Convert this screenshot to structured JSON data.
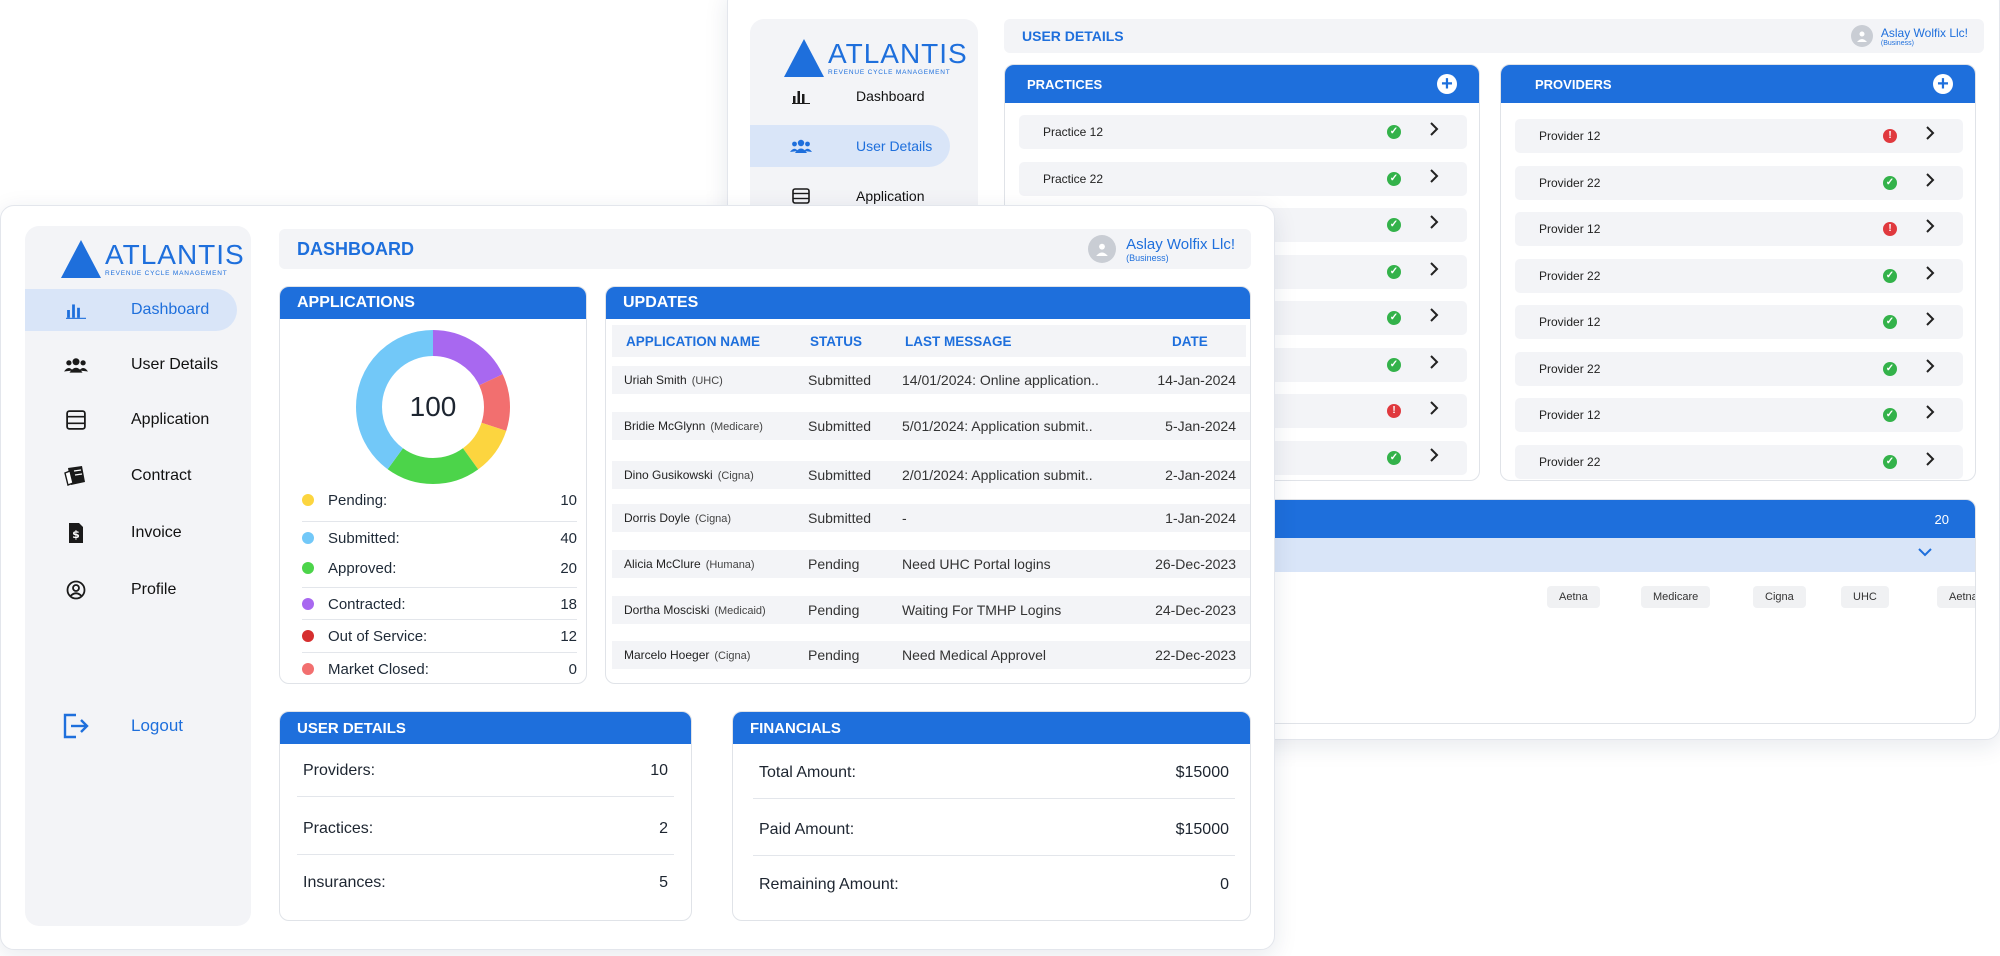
{
  "brand": {
    "name": "ATLANTIS",
    "tagline": "REVENUE CYCLE MANAGEMENT"
  },
  "colors": {
    "primary": "#1e6fdc",
    "ok": "#33b24a",
    "error": "#e0393e"
  },
  "user": {
    "name": "Aslay Wolfix Llc!",
    "role": "(Business)"
  },
  "back": {
    "title": "USER DETAILS",
    "nav": [
      {
        "label": "Dashboard",
        "icon": "bar-chart-icon"
      },
      {
        "label": "User Details",
        "icon": "users-icon"
      },
      {
        "label": "Application",
        "icon": "list-icon"
      }
    ],
    "practices": {
      "title": "PRACTICES",
      "items": [
        {
          "label": "Practice 12",
          "status": "ok"
        },
        {
          "label": "Practice 22",
          "status": "ok"
        },
        {
          "label": "",
          "status": "ok"
        },
        {
          "label": "",
          "status": "ok"
        },
        {
          "label": "",
          "status": "ok"
        },
        {
          "label": "",
          "status": "ok"
        },
        {
          "label": "",
          "status": "err"
        },
        {
          "label": "",
          "status": "ok"
        }
      ]
    },
    "providers": {
      "title": "PROVIDERS",
      "items": [
        {
          "label": "Provider 12",
          "status": "err"
        },
        {
          "label": "Provider 22",
          "status": "ok"
        },
        {
          "label": "Provider 12",
          "status": "err"
        },
        {
          "label": "Provider 22",
          "status": "ok"
        },
        {
          "label": "Provider 12",
          "status": "ok"
        },
        {
          "label": "Provider 22",
          "status": "ok"
        },
        {
          "label": "Provider 12",
          "status": "ok"
        },
        {
          "label": "Provider 22",
          "status": "ok"
        }
      ]
    },
    "insurances": {
      "count": "20",
      "chips": [
        "Aetna",
        "Medicare",
        "Cigna",
        "UHC",
        "Aetna"
      ]
    }
  },
  "front": {
    "title": "DASHBOARD",
    "nav": [
      {
        "label": "Dashboard",
        "icon": "bar-chart-icon"
      },
      {
        "label": "User Details",
        "icon": "users-icon"
      },
      {
        "label": "Application",
        "icon": "list-icon"
      },
      {
        "label": "Contract",
        "icon": "contract-icon"
      },
      {
        "label": "Invoice",
        "icon": "invoice-icon"
      },
      {
        "label": "Profile",
        "icon": "profile-icon"
      }
    ],
    "logout": "Logout",
    "applications": {
      "title": "APPLICATIONS",
      "total": "100",
      "legend": [
        {
          "label": "Pending:",
          "value": "10",
          "color": "#fcd53f"
        },
        {
          "label": "Submitted:",
          "value": "40",
          "color": "#72c8f8"
        },
        {
          "label": "Approved:",
          "value": "20",
          "color": "#4cd44a"
        },
        {
          "label": "Contracted:",
          "value": "18",
          "color": "#a868f0"
        },
        {
          "label": "Out of Service:",
          "value": "12",
          "color": "#d62f2f"
        },
        {
          "label": "Market Closed:",
          "value": "0",
          "color": "#f26f6f"
        }
      ]
    },
    "updates": {
      "title": "UPDATES",
      "columns": [
        "APPLICATION NAME",
        "STATUS",
        "LAST MESSAGE",
        "DATE"
      ],
      "rows": [
        {
          "name": "Uriah Smith",
          "ins": "(UHC)",
          "status": "Submitted",
          "msg": "14/01/2024: Online application..",
          "date": "14-Jan-2024"
        },
        {
          "name": "Bridie McGlynn",
          "ins": "(Medicare)",
          "status": "Submitted",
          "msg": "5/01/2024: Application submit..",
          "date": "5-Jan-2024"
        },
        {
          "name": "Dino Gusikowski",
          "ins": "(Cigna)",
          "status": "Submitted",
          "msg": "2/01/2024: Application submit..",
          "date": "2-Jan-2024"
        },
        {
          "name": "Dorris Doyle",
          "ins": "(Cigna)",
          "status": "Submitted",
          "msg": "-",
          "date": "1-Jan-2024"
        },
        {
          "name": "Alicia McClure",
          "ins": "(Humana)",
          "status": "Pending",
          "msg": "Need UHC Portal logins",
          "date": "26-Dec-2023"
        },
        {
          "name": "Dortha Mosciski",
          "ins": "(Medicaid)",
          "status": "Pending",
          "msg": "Waiting For TMHP Logins",
          "date": "24-Dec-2023"
        },
        {
          "name": "Marcelo Hoeger",
          "ins": "(Cigna)",
          "status": "Pending",
          "msg": "Need Medical Approvel",
          "date": "22-Dec-2023"
        }
      ]
    },
    "user_details": {
      "title": "USER DETAILS",
      "rows": [
        {
          "label": "Providers:",
          "value": "10"
        },
        {
          "label": "Practices:",
          "value": "2"
        },
        {
          "label": "Insurances:",
          "value": "5"
        }
      ]
    },
    "financials": {
      "title": "FINANCIALS",
      "rows": [
        {
          "label": "Total Amount:",
          "value": "$15000"
        },
        {
          "label": "Paid Amount:",
          "value": "$15000"
        },
        {
          "label": "Remaining Amount:",
          "value": "0"
        }
      ]
    }
  }
}
